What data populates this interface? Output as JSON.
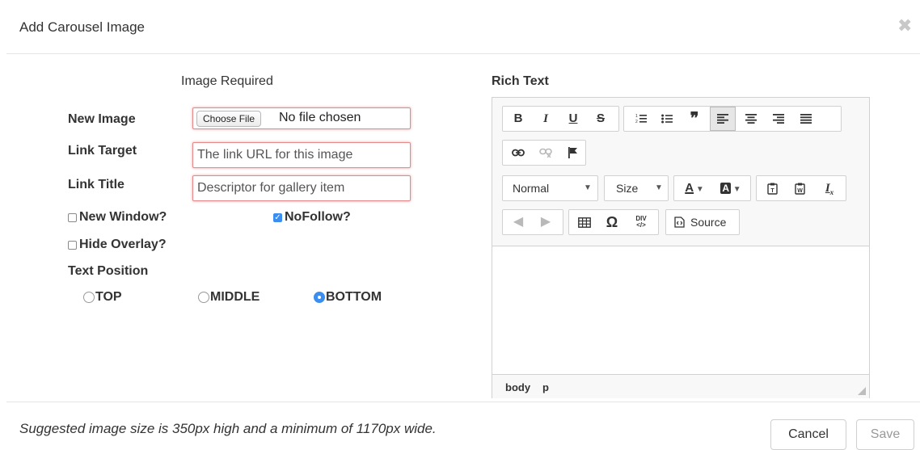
{
  "modal": {
    "title": "Add Carousel Image",
    "close_icon": "close-icon"
  },
  "form": {
    "image_required": "Image Required",
    "new_image": {
      "label": "New Image",
      "button": "Choose File",
      "status": "No file chosen"
    },
    "link_target": {
      "label": "Link Target",
      "placeholder": "The link URL for this image"
    },
    "link_title": {
      "label": "Link Title",
      "placeholder": "Descriptor for gallery item"
    },
    "checkboxes": {
      "new_window": {
        "label": "New Window?",
        "checked": false
      },
      "nofollow": {
        "label": "NoFollow?",
        "checked": true
      },
      "hide_overlay": {
        "label": "Hide Overlay?",
        "checked": false
      }
    },
    "text_position": {
      "label": "Text Position",
      "options": [
        "TOP",
        "MIDDLE",
        "BOTTOM"
      ],
      "selected": "BOTTOM"
    }
  },
  "rich_text": {
    "label": "Rich Text",
    "toolbar": {
      "bold": "B",
      "italic": "I",
      "underline": "U",
      "strike": "S",
      "format_combo": "Normal",
      "size_combo": "Size",
      "text_color": "A",
      "bg_color": "A",
      "remove_format": "I",
      "omega": "Ω",
      "source": "Source",
      "div": "DIV"
    },
    "status_path": [
      "body",
      "p"
    ]
  },
  "footer": {
    "hint": "Suggested image size is 350px high and a minimum of 1170px wide.",
    "cancel": "Cancel",
    "save": "Save"
  },
  "colors": {
    "accent": "#3b8ef0",
    "error_border": "#e48a8a"
  }
}
